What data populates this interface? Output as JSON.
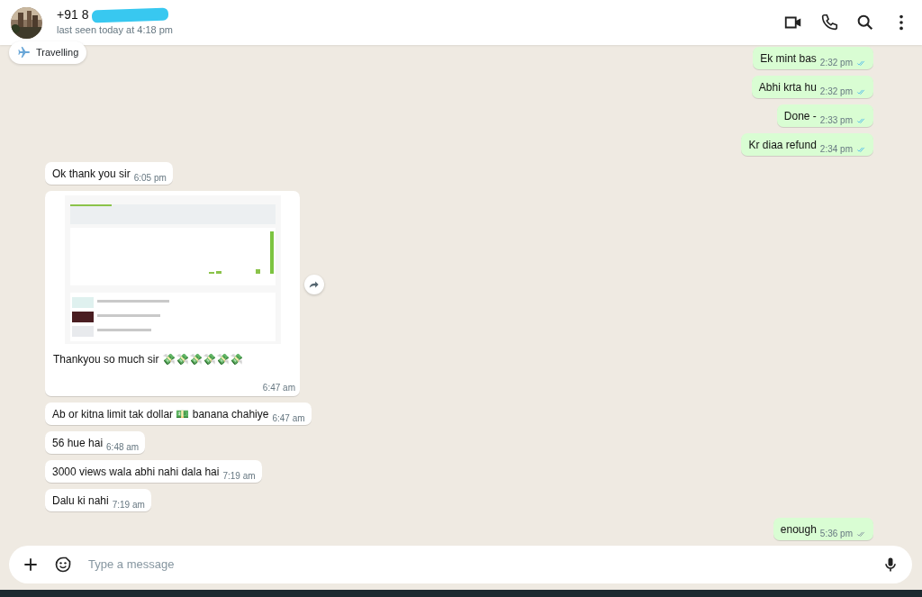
{
  "contact": {
    "name": "+91 8",
    "last_seen": "last seen today at 4:18 pm",
    "status": "Travelling"
  },
  "messages": [
    {
      "kind": "text",
      "outgoing": true,
      "text": "Ek mint bas",
      "time": "2:32 pm",
      "read": true
    },
    {
      "kind": "text",
      "outgoing": true,
      "text": "Abhi krta hu",
      "time": "2:32 pm",
      "read": true
    },
    {
      "kind": "text",
      "outgoing": true,
      "text": "Done -",
      "time": "2:33 pm",
      "read": true
    },
    {
      "kind": "text",
      "outgoing": true,
      "text": "Kr diaa refund",
      "time": "2:34 pm",
      "read": true
    },
    {
      "kind": "text",
      "outgoing": false,
      "text": "Ok thank you sir",
      "time": "6:05 pm"
    },
    {
      "outgoing": false,
      "text": "Thankyou so much sir 💸💸💸💸💸💸",
      "time": "6:47 am"
    },
    {
      "kind": "text",
      "outgoing": false,
      "text": "Ab or kitna limit tak dollar 💵 banana chahiye",
      "time": "6:47 am"
    },
    {
      "kind": "text",
      "outgoing": false,
      "text": "56 hue hai",
      "time": "6:48 am"
    },
    {
      "kind": "text",
      "outgoing": false,
      "text": "3000 views wala abhi nahi dala hai",
      "time": "7:19 am"
    },
    {
      "kind": "text",
      "outgoing": false,
      "text": "Dalu ki nahi",
      "time": "7:19 am"
    },
    {
      "kind": "text",
      "outgoing": true,
      "text": "enough",
      "time": "5:36 pm",
      "read": false
    }
  ],
  "composer": {
    "placeholder": "Type a message"
  }
}
